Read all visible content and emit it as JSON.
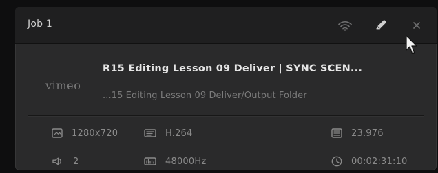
{
  "job": {
    "title": "Job 1",
    "name": "R15 Editing Lesson 09 Deliver | SYNC SCEN...",
    "path": "...15 Editing Lesson 09 Deliver/Output Folder",
    "logo_text": "vimeo"
  },
  "header": {
    "icons": [
      "wifi-icon",
      "edit-icon",
      "close-icon"
    ]
  },
  "meta": {
    "resolution": "1280x720",
    "codec": "H.264",
    "fps": "23.976",
    "audio_channels": "2",
    "sample_rate": "48000Hz",
    "duration": "00:02:31:10"
  },
  "colors": {
    "background": "#0f0f10",
    "card": "#2a2a2b",
    "header": "#1f1f20",
    "text_primary": "#e6e6e6",
    "text_secondary": "#7b7b7b",
    "icon": "#6f6f70"
  }
}
